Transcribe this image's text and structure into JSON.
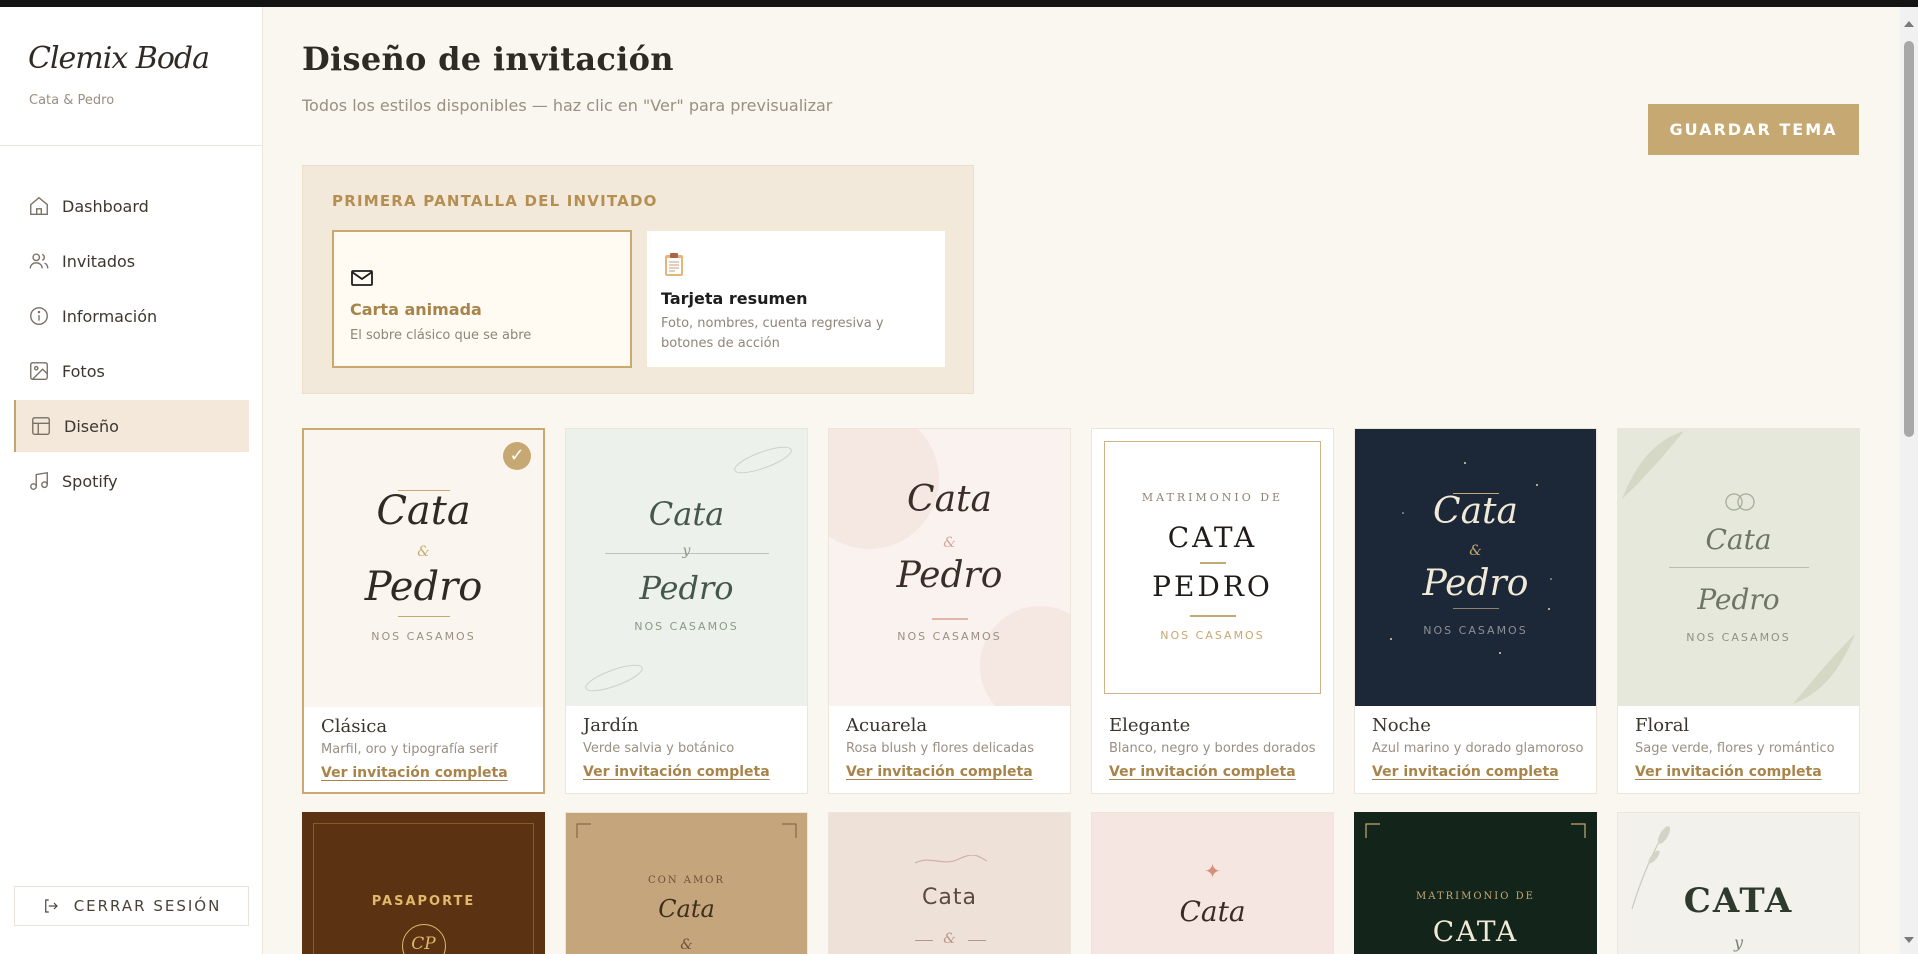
{
  "brand": {
    "name": "Clemix Boda",
    "couple": "Cata & Pedro"
  },
  "nav": [
    {
      "label": "Dashboard",
      "icon": "home-icon"
    },
    {
      "label": "Invitados",
      "icon": "users-icon"
    },
    {
      "label": "Información",
      "icon": "info-icon"
    },
    {
      "label": "Fotos",
      "icon": "image-icon"
    },
    {
      "label": "Diseño",
      "icon": "layout-icon",
      "active": true
    },
    {
      "label": "Spotify",
      "icon": "music-icon"
    }
  ],
  "logout_label": "CERRAR SESIÓN",
  "header": {
    "title": "Diseño de invitación",
    "subtitle": "Todos los estilos disponibles — haz clic en \"Ver\" para previsualizar",
    "save_label": "GUARDAR TEMA"
  },
  "first_screen": {
    "title": "PRIMERA PANTALLA DEL INVITADO",
    "options": [
      {
        "name": "Carta animada",
        "desc": "El sobre clásico que se abre",
        "selected": true
      },
      {
        "name": "Tarjeta resumen",
        "desc": "Foto, nombres, cuenta regresiva y botones de acción",
        "selected": false
      }
    ]
  },
  "theme_link_label": "Ver invitación completa",
  "themes": [
    {
      "name": "Clásica",
      "desc": "Marfil, oro y tipografía serif",
      "selected": true,
      "preview": {
        "line1": "Cata",
        "amp": "&",
        "line2": "Pedro",
        "tag": "NOS CASAMOS"
      }
    },
    {
      "name": "Jardín",
      "desc": "Verde salvia y botánico",
      "preview": {
        "line1": "Cata",
        "amp": "y",
        "line2": "Pedro",
        "tag": "NOS CASAMOS"
      }
    },
    {
      "name": "Acuarela",
      "desc": "Rosa blush y flores delicadas",
      "preview": {
        "line1": "Cata",
        "amp": "&",
        "line2": "Pedro",
        "tag": "NOS CASAMOS"
      }
    },
    {
      "name": "Elegante",
      "desc": "Blanco, negro y bordes dorados",
      "preview": {
        "top": "MATRIMONIO DE",
        "line1": "CATA",
        "line2": "PEDRO",
        "tag": "NOS CASAMOS"
      }
    },
    {
      "name": "Noche",
      "desc": "Azul marino y dorado glamoroso",
      "preview": {
        "line1": "Cata",
        "amp": "&",
        "line2": "Pedro",
        "tag": "NOS CASAMOS"
      }
    },
    {
      "name": "Floral",
      "desc": "Sage verde, flores y romántico",
      "preview": {
        "line1": "Cata",
        "line2": "Pedro",
        "tag": "NOS CASAMOS"
      }
    }
  ],
  "themes_row2": [
    {
      "line1": "PASAPORTE",
      "monogram": "CP"
    },
    {
      "top": "CON AMOR",
      "line1": "Cata",
      "amp": "&"
    },
    {
      "line1": "Cata",
      "amp": "&"
    },
    {
      "line1": "Cata"
    },
    {
      "top": "MATRIMONIO DE",
      "line1": "CATA"
    },
    {
      "line1": "CATA",
      "amp": "y"
    }
  ],
  "colors": {
    "gold": "#c5a872",
    "accent_text": "#a8844a",
    "active_nav_bg": "#f3e8d9"
  }
}
